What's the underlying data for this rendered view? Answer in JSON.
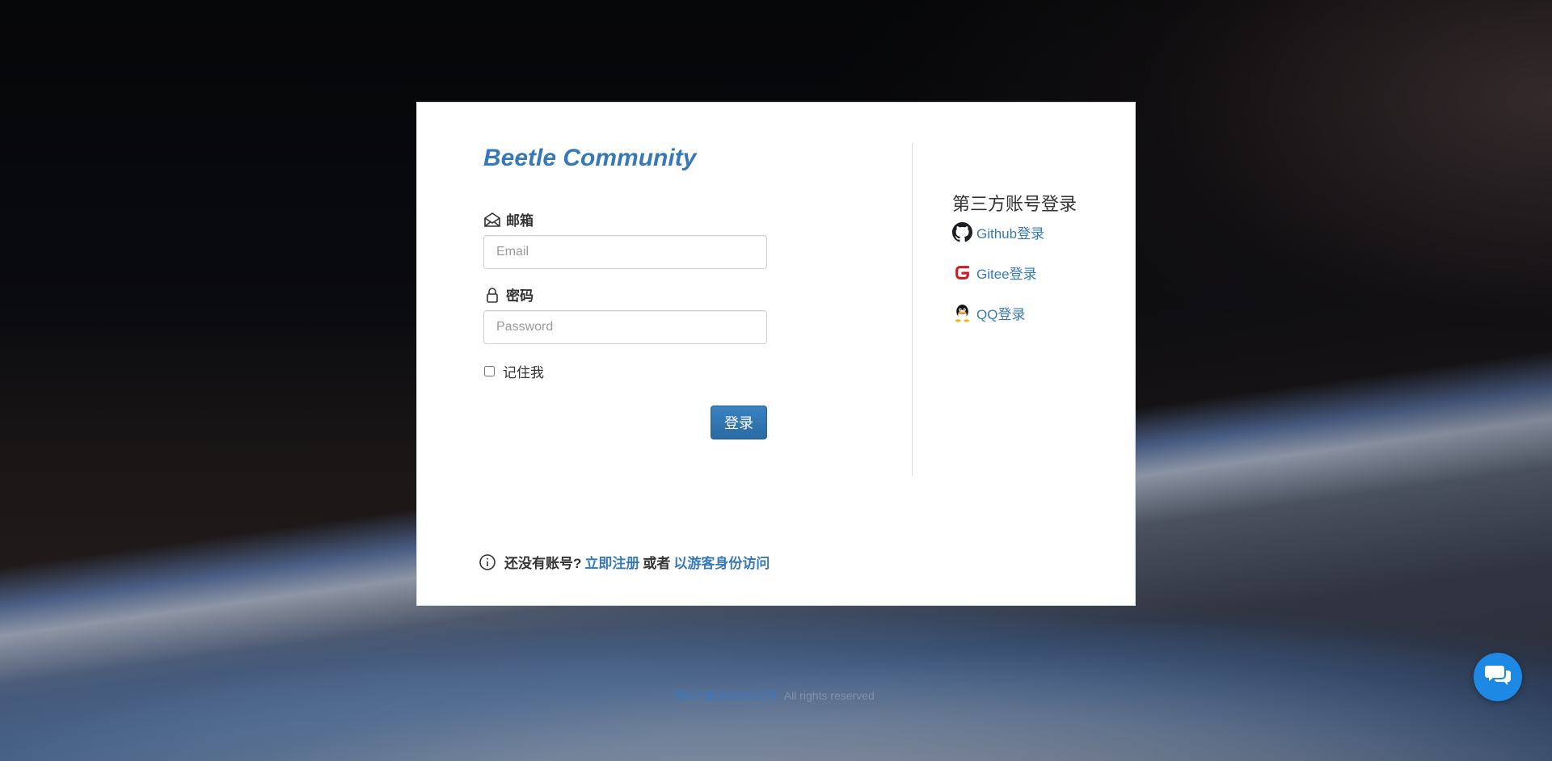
{
  "brand": {
    "title": "Beetle Community"
  },
  "login_form": {
    "email_label": "邮箱",
    "email_placeholder": "Email",
    "email_value": "",
    "password_label": "密码",
    "password_placeholder": "Password",
    "password_value": "",
    "remember_label": "记住我",
    "remember_checked": false,
    "submit_label": "登录"
  },
  "third_party": {
    "title": "第三方账号登录",
    "providers": [
      {
        "label": "Github登录",
        "icon": "github-icon"
      },
      {
        "label": "Gitee登录",
        "icon": "gitee-icon"
      },
      {
        "label": "QQ登录",
        "icon": "qq-icon"
      }
    ]
  },
  "footer_note": {
    "prefix": "还没有账号?",
    "register_link": "立即注册",
    "or": "或者",
    "guest_link": "以游客身份访问"
  },
  "site_footer": {
    "icp_link": "赣ICP备20005052号",
    "rights": "All rights reserved"
  },
  "colors": {
    "accent": "#337ab7",
    "link": "#3779b6",
    "gitee": "#c71d23",
    "chat": "#1e88e5"
  }
}
